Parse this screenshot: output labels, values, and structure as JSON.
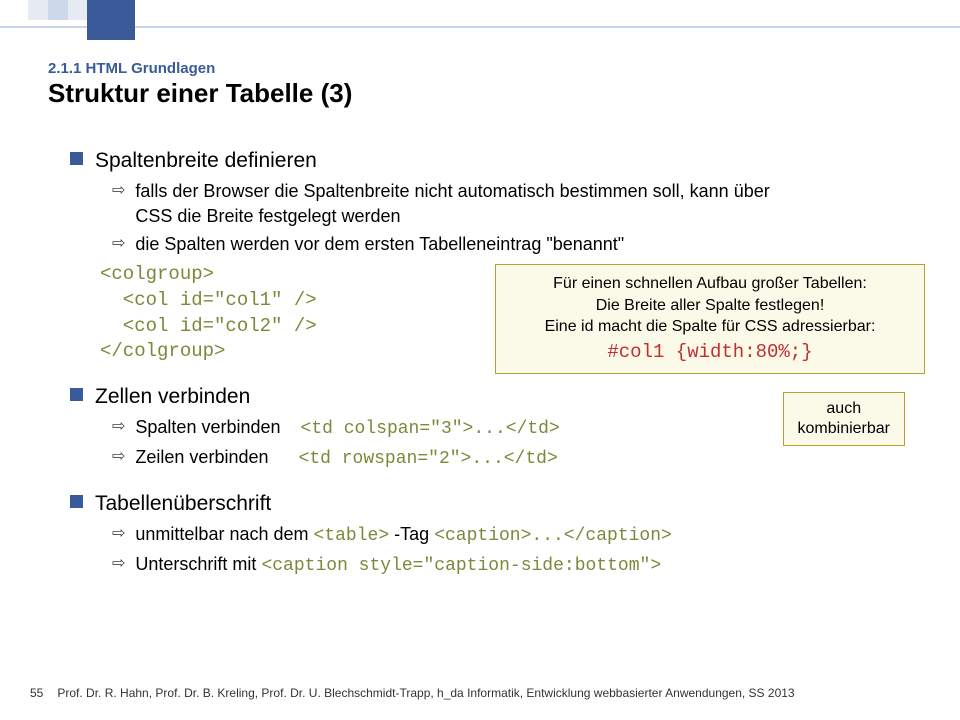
{
  "header": {
    "section_number": "2.1.1 HTML Grundlagen",
    "title": "Struktur einer Tabelle (3)"
  },
  "body": {
    "p1": {
      "heading": "Spaltenbreite definieren",
      "sub1": "falls der Browser die Spaltenbreite nicht automatisch bestimmen soll, kann über CSS die Breite festgelegt werden",
      "sub2": "die Spalten werden vor dem ersten Tabelleneintrag \"benannt\"",
      "code": "<colgroup>\n  <col id=\"col1\" />\n  <col id=\"col2\" />\n</colgroup>"
    },
    "p2": {
      "heading": "Zellen verbinden",
      "sub1_label": "Spalten verbinden",
      "sub1_code": "<td colspan=\"3\">...</td>",
      "sub2_label": "Zeilen verbinden",
      "sub2_code": "<td rowspan=\"2\">...</td>"
    },
    "p3": {
      "heading": "Tabellenüberschrift",
      "sub1_a": "unmittelbar nach dem",
      "sub1_code1": "<table>",
      "sub1_b": "-Tag",
      "sub1_code2": "<caption>...</caption>",
      "sub2_a": "Unterschrift mit",
      "sub2_code": "<caption style=\"caption-side:bottom\">"
    }
  },
  "callout1": {
    "line1": "Für einen schnellen Aufbau großer Tabellen:",
    "line2": "Die Breite aller Spalte festlegen!",
    "line3": "Eine id macht die Spalte für CSS adressierbar:",
    "code": "#col1 {width:80%;}"
  },
  "callout2": {
    "line1": "auch",
    "line2": "kombinierbar"
  },
  "footer": {
    "page": "55",
    "credits": "Prof. Dr. R. Hahn, Prof. Dr. B. Kreling, Prof. Dr. U. Blechschmidt-Trapp,  h_da Informatik, Entwicklung webbasierter Anwendungen, SS 2013"
  }
}
